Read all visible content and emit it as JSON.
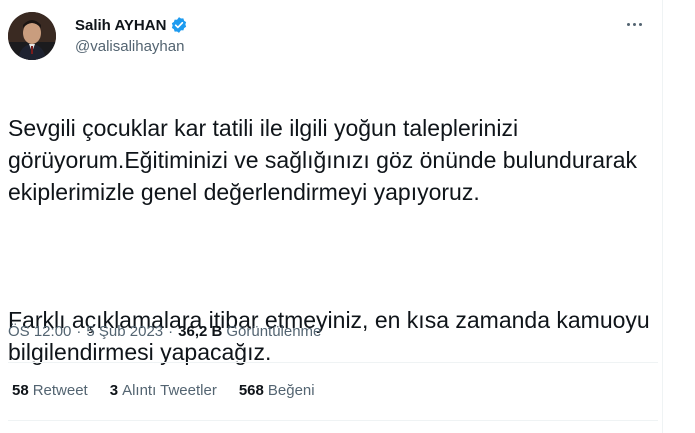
{
  "author": {
    "name": "Salih AYHAN",
    "handle": "@valisalihayhan"
  },
  "tweet": {
    "paragraph1": "Sevgili çocuklar kar tatili ile ilgili yoğun taleplerinizi görüyorum.Eğitiminizi ve sağlığınızı göz önünde bulundurarak ekiplerimizle genel değerlendirmeyi yapıyoruz.",
    "paragraph2": "Farklı açıklamalara itibar etmeyiniz, en kısa zamanda kamuoyu bilgilendirmesi yapacağız."
  },
  "meta": {
    "time": "ÖS 12:00",
    "separator": "·",
    "date": "5 Şub 2023",
    "views_count": "36,2 B",
    "views_label": "Görüntülenme"
  },
  "stats": {
    "retweets_count": "58",
    "retweets_label": "Retweet",
    "quotes_count": "3",
    "quotes_label": "Alıntı Tweetler",
    "likes_count": "568",
    "likes_label": "Beğeni"
  },
  "icons": {
    "verified": "verified-badge-icon",
    "more": "more-options-icon"
  },
  "colors": {
    "verified_blue": "#1d9bf0",
    "secondary_text": "#536471",
    "primary_text": "#0f1419"
  }
}
